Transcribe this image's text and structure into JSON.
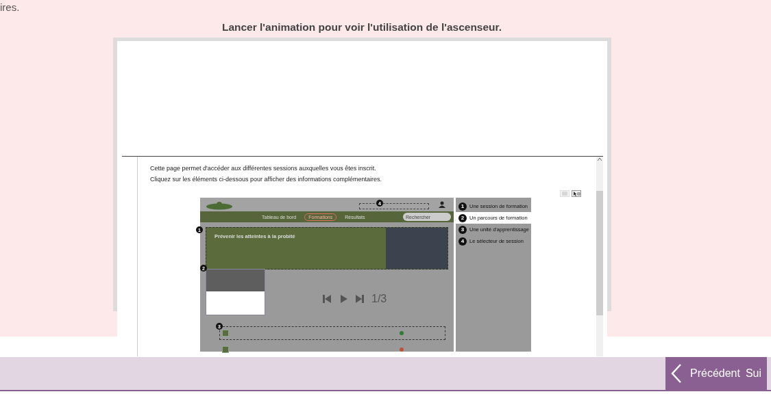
{
  "page_text_fragment": "ires.",
  "caption": "Lancer l'animation pour voir l'utilisation de l'ascenseur.",
  "document": {
    "intro_lines": [
      "Cette page permet d'accéder aux différentes sessions auxquelles vous êtes inscrit.",
      "Cliquez sur les éléments ci-dessous pour afficher des informations complémentaires."
    ]
  },
  "app_screenshot": {
    "nav": [
      {
        "label": "Tableau de bord",
        "selected": false
      },
      {
        "label": "Formations",
        "selected": true
      },
      {
        "label": "Résultats",
        "selected": false
      }
    ],
    "search": {
      "placeholder": "Rechercher"
    },
    "hero_title": "Prévenir les atteintes à la probité",
    "markers": [
      "1",
      "2",
      "3",
      "4"
    ]
  },
  "legend": [
    {
      "number": "1",
      "label": "Une session de formation",
      "selected": false
    },
    {
      "number": "2",
      "label": "Un parcours de formation",
      "selected": true
    },
    {
      "number": "3",
      "label": "Une unité d'apprentissage",
      "selected": false
    },
    {
      "number": "4",
      "label": "Le sélecteur de session",
      "selected": false
    }
  ],
  "player": {
    "counter": "1/3"
  },
  "footer": {
    "buttons": [
      "Précédent",
      "Sui"
    ]
  }
}
